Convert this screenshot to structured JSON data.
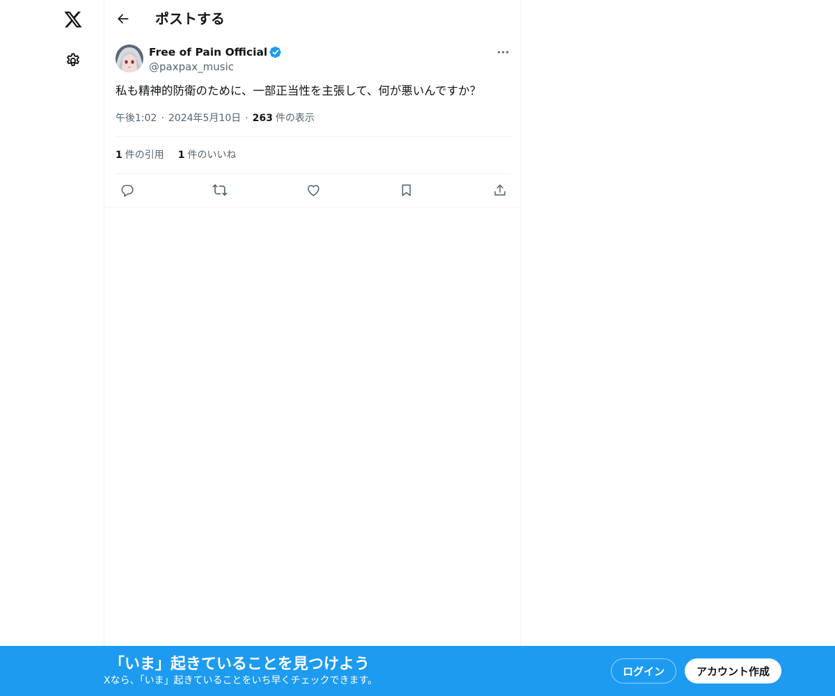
{
  "header": {
    "title": "ポストする"
  },
  "post": {
    "author_name": "Free of Pain Official",
    "author_handle": "@paxpax_music",
    "text": "私も精神的防衛のために、一部正当性を主張して、何が悪いんですか？",
    "time": "午後1:02",
    "date": "2024年5月10日",
    "views_count": "263",
    "views_label": "件の表示",
    "separator": "·"
  },
  "stats": {
    "quotes_count": "1",
    "quotes_label": "件の引用",
    "likes_count": "1",
    "likes_label": "件のいいね"
  },
  "icons": {
    "logo": "x-logo-icon",
    "settings": "gear-icon",
    "back": "arrow-left-icon",
    "verified": "verified-badge-icon",
    "more": "more-horizontal-icon",
    "reply": "reply-icon",
    "repost": "repost-icon",
    "like": "heart-icon",
    "bookmark": "bookmark-icon",
    "share": "share-icon"
  },
  "colors": {
    "accent": "#1d9bf0",
    "text_primary": "#0f1419",
    "text_secondary": "#536471",
    "border": "#eff3f4"
  },
  "bottom_bar": {
    "title": "「いま」起きていることを見つけよう",
    "subtitle": "Xなら、「いま」起きていることをいち早くチェックできます。",
    "login_label": "ログイン",
    "signup_label": "アカウント作成"
  }
}
